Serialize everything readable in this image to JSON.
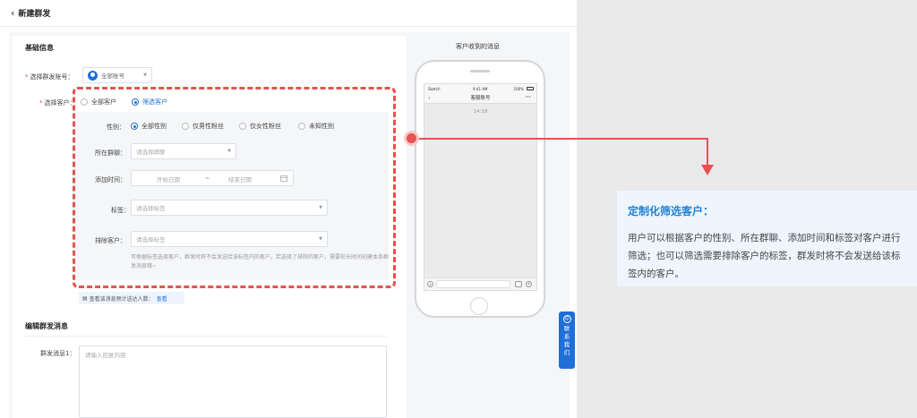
{
  "header": {
    "back_icon": "chevron-left-icon",
    "title": "新建群发"
  },
  "basic_info": {
    "section_title": "基础信息",
    "account": {
      "label": "选择群发账号：",
      "value": "全部账号"
    },
    "customer": {
      "label": "选择客户：",
      "options": [
        "全部客户",
        "筛选客户"
      ],
      "selected": "筛选客户"
    },
    "filters": {
      "gender": {
        "label": "性别：",
        "options": [
          "全部性别",
          "仅男性粉丝",
          "仅女性粉丝",
          "未知性别"
        ],
        "selected": "全部性别"
      },
      "group": {
        "label": "所在群聊：",
        "placeholder": "请选择群聊"
      },
      "added_time": {
        "label": "添加时间：",
        "start_placeholder": "开始日期",
        "separator": "~",
        "end_placeholder": "结束日期"
      },
      "tags": {
        "label": "标签：",
        "placeholder": "请选择标签"
      },
      "exclude": {
        "label": "排除客户：",
        "placeholder": "请选择标签"
      },
      "hint": "可根据标签选择客户，群发时将不会发送给该标签内的客户。若选择了排除的客户，需要较长时间创建本条群发消息哦~"
    },
    "reach_tip": {
      "text": "查看该消息预计送达人数：",
      "link": "查看"
    }
  },
  "edit_message": {
    "section_title": "编辑群发消息",
    "label": "群发消息1：",
    "placeholder": "请输入回复内容"
  },
  "preview": {
    "label": "客户收到的消息",
    "status_bar": {
      "carrier": "Sketch",
      "time": "9:41 AM",
      "battery": "100%"
    },
    "nav_title": "客服账号",
    "chat_time": "14:18"
  },
  "contact": {
    "label": "联系我们"
  },
  "callout": {
    "title": "定制化筛选客户：",
    "body": "用户可以根据客户的性别、所在群聊、添加时间和标签对客户进行筛选；也可以筛选需要排除客户的标签，群发时将不会发送给该标签内的客户。"
  },
  "colors": {
    "accent": "#1e6fd9",
    "highlight": "#e4534f",
    "callout_title": "#1e82d6"
  }
}
